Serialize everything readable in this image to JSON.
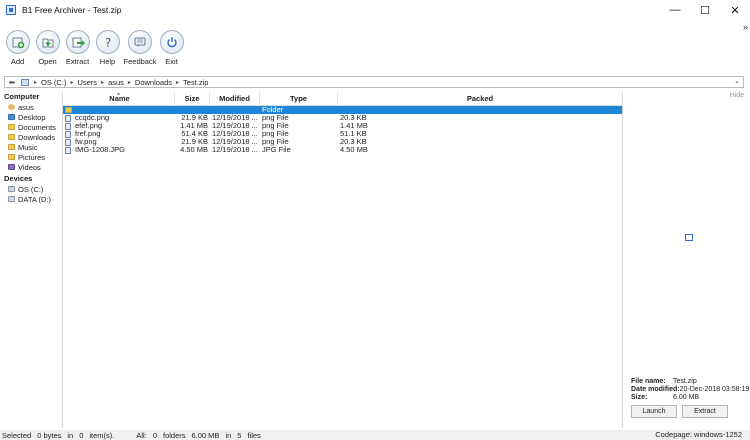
{
  "window": {
    "title": "B1 Free Archiver - Test.zip",
    "controls": {
      "minimize": "—",
      "maximize": "☐",
      "close": "✕"
    },
    "overflow": "»"
  },
  "toolbar": {
    "buttons": [
      {
        "label": "Add",
        "icon": "add-icon"
      },
      {
        "label": "Open",
        "icon": "open-icon"
      },
      {
        "label": "Extract",
        "icon": "extract-icon"
      },
      {
        "label": "Help",
        "icon": "help-icon"
      },
      {
        "label": "Feedback",
        "icon": "feedback-icon"
      },
      {
        "label": "Exit",
        "icon": "power-icon"
      }
    ]
  },
  "address": {
    "crumbs": [
      "OS (C:)",
      "Users",
      "asus",
      "Downloads",
      "Test.zip"
    ],
    "dropdown": "⌄"
  },
  "tree": {
    "computer_label": "Computer",
    "computer_items": [
      "asus",
      "Desktop",
      "Documents",
      "Downloads",
      "Music",
      "Pictures",
      "Videos"
    ],
    "devices_label": "Devices",
    "devices_items": [
      "OS (C:)",
      "DATA (D:)"
    ]
  },
  "list": {
    "columns": [
      "Name",
      "Size",
      "Modified",
      "Type",
      "Packed"
    ],
    "rows": [
      {
        "name": "",
        "size": "",
        "modified": "",
        "type": "Folder",
        "packed": "",
        "selected": true,
        "folder": true
      },
      {
        "name": "ccqdc.png",
        "size": "21.9 KB",
        "modified": "12/19/2018 ...",
        "type": "png File",
        "packed": "20.3 KB"
      },
      {
        "name": "efef.png",
        "size": "1.41 MB",
        "modified": "12/19/2018 ...",
        "type": "png File",
        "packed": "1.41 MB"
      },
      {
        "name": "fref.png",
        "size": "51.4 KB",
        "modified": "12/19/2018 ...",
        "type": "png File",
        "packed": "51.1 KB"
      },
      {
        "name": "fw.png",
        "size": "21.9 KB",
        "modified": "12/19/2018 ...",
        "type": "png File",
        "packed": "20.3 KB"
      },
      {
        "name": "IMG-1208.JPG",
        "size": "4.50 MB",
        "modified": "12/19/2018 ...",
        "type": "JPG File",
        "packed": "4.50 MB"
      }
    ]
  },
  "panel": {
    "hide": "Hide",
    "file_name_label": "File name:",
    "file_name": "Test.zip",
    "date_modified_label": "Date modified:",
    "date_modified": "20-Dec-2018 03:58:19",
    "size_label": "Size:",
    "size": "6.00 MB",
    "launch": "Launch",
    "extract": "Extract"
  },
  "status": {
    "selected": "Selected",
    "sel_bytes": "0 bytes",
    "in1": "in",
    "sel_items": "0",
    "items_word": "item(s).",
    "all": "All:",
    "folders_count": "0",
    "folders_word": "folders",
    "total_size": "6.00 MB",
    "in2": "in",
    "files_count": "5",
    "files_word": "files",
    "codepage": "Codepage: windows-1252"
  }
}
